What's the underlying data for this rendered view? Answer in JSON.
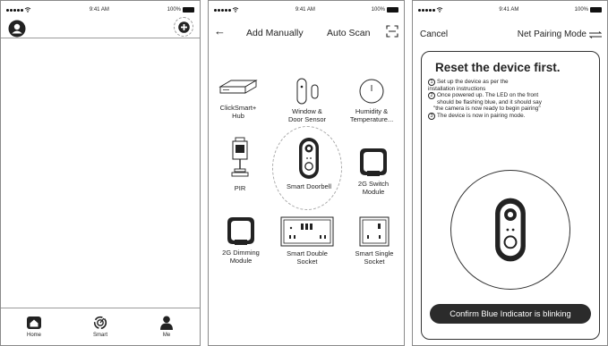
{
  "status": {
    "time": "9:41 AM",
    "battery": "100%"
  },
  "home": {
    "tabs": [
      {
        "label": "Home",
        "icon": "home-icon"
      },
      {
        "label": "Smart",
        "icon": "smart-icon"
      },
      {
        "label": "Me",
        "icon": "person-icon"
      }
    ]
  },
  "add": {
    "back_icon": "←",
    "title": "Add Manually",
    "scan_label": "Auto Scan",
    "devices": [
      {
        "label": "ClickSmart+ Hub",
        "line1": "ClickSmart+",
        "line2": "Hub"
      },
      {
        "label": "Window & Door Sensor",
        "line1": "Window &",
        "line2": "Door Sensor"
      },
      {
        "label": "Humidity & Temperature...",
        "line1": "Humidity &",
        "line2": "Temperature..."
      },
      {
        "label": "PIR",
        "line1": "PIR",
        "line2": ""
      },
      {
        "label": "Smart Doorbell",
        "line1": "Smart Doorbell",
        "line2": ""
      },
      {
        "label": "2G Switch Module",
        "line1": "2G Switch",
        "line2": "Module"
      },
      {
        "label": "2G Dimming Module",
        "line1": "2G Dimming",
        "line2": "Module"
      },
      {
        "label": "Smart Double Socket",
        "line1": "Smart Double",
        "line2": "Socket"
      },
      {
        "label": "Smart Single Socket",
        "line1": "Smart Single",
        "line2": "Socket"
      }
    ]
  },
  "pairing": {
    "cancel": "Cancel",
    "mode": "Net Pairing Mode",
    "heading": "Reset the device first.",
    "steps": [
      {
        "num": "1",
        "text": "Set up the device as per the",
        "cont": "installation instructions"
      },
      {
        "num": "2",
        "text": "Once powered up. The LED on the front",
        "cont": "should be flashing blue, and it should say",
        "cont2": "\"the camera is now ready to begin pairing\""
      },
      {
        "num": "3",
        "text": "The device is now in pairing mode.",
        "cont": ""
      }
    ],
    "confirm": "Confirm Blue Indicator is blinking"
  },
  "colors": {
    "text": "#222222",
    "button_bg": "#2b2b2b",
    "border": "#8a8a8a"
  }
}
